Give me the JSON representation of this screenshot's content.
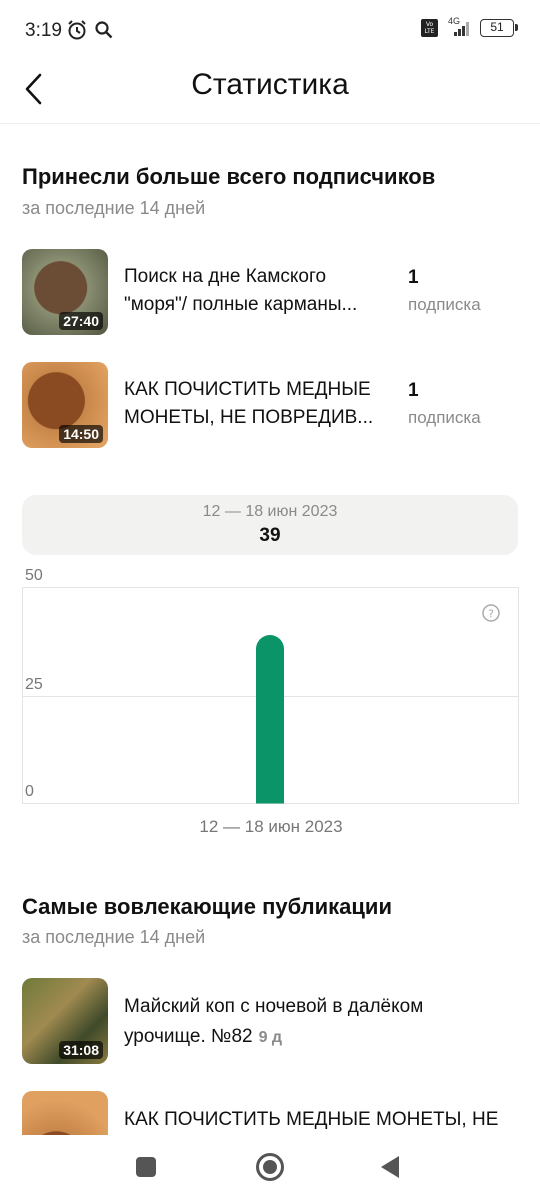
{
  "status_bar": {
    "time": "3:19",
    "network": "4G",
    "volte": "Vo\nLTE",
    "battery": "51"
  },
  "header": {
    "title": "Статистика"
  },
  "top_subscribers": {
    "title": "Принесли больше всего подписчиков",
    "subtitle": "за последние 14 дней",
    "items": [
      {
        "line1": "Поиск на дне Камского",
        "line2": "\"моря\"/ полные карманы...",
        "duration": "27:40",
        "count": "1",
        "count_label": "подписка"
      },
      {
        "line1": "КАК ПОЧИСТИТЬ МЕДНЫЕ",
        "line2": "МОНЕТЫ, НЕ ПОВРЕДИВ...",
        "duration": "14:50",
        "count": "1",
        "count_label": "подписка"
      }
    ]
  },
  "tooltip": {
    "date": "12 — 18 июн 2023",
    "value": "39"
  },
  "chart_data": {
    "type": "bar",
    "categories": [
      "12 — 18 июн 2023"
    ],
    "values": [
      39
    ],
    "ylim": [
      0,
      50
    ],
    "y_ticks": [
      "50",
      "25",
      "0"
    ],
    "x_label": "12 — 18 июн 2023",
    "bar_color": "#0a9467",
    "grid": true
  },
  "engaging": {
    "title": "Самые вовлекающие публикации",
    "subtitle": "за последние 14 дней",
    "items": [
      {
        "line1": "Майский коп с ночевой в далёком",
        "line2": "урочище. №82",
        "age": "9 д",
        "duration": "31:08"
      },
      {
        "line1": "КАК ПОЧИСТИТЬ МЕДНЫЕ МОНЕТЫ, НЕ",
        "line2": "",
        "age": "",
        "duration": ""
      }
    ]
  },
  "colors": {
    "accent_green": "#0a9467",
    "muted_text": "#8a8a8a"
  }
}
